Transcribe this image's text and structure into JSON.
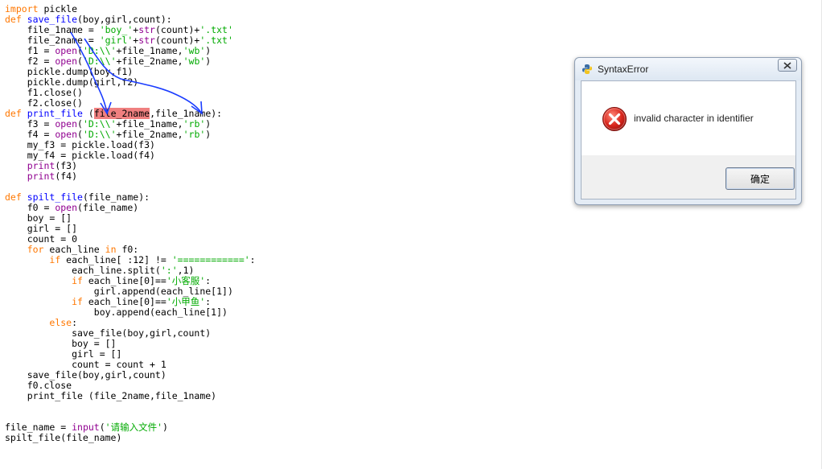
{
  "code_lines": [
    [
      {
        "t": "import",
        "c": "kw"
      },
      {
        "t": " pickle"
      }
    ],
    [
      {
        "t": "def",
        "c": "kw"
      },
      {
        "t": " "
      },
      {
        "t": "save_file",
        "c": "fn"
      },
      {
        "t": "(boy,girl,count):"
      }
    ],
    [
      {
        "t": "    file_1name = "
      },
      {
        "t": "'boy_'",
        "c": "str"
      },
      {
        "t": "+"
      },
      {
        "t": "str",
        "c": "bi"
      },
      {
        "t": "(count)+"
      },
      {
        "t": "'.txt'",
        "c": "str"
      }
    ],
    [
      {
        "t": "    file_2name = "
      },
      {
        "t": "'girl'",
        "c": "str"
      },
      {
        "t": "+"
      },
      {
        "t": "str",
        "c": "bi"
      },
      {
        "t": "(count)+"
      },
      {
        "t": "'.txt'",
        "c": "str"
      }
    ],
    [
      {
        "t": "    f1 = "
      },
      {
        "t": "open",
        "c": "bi"
      },
      {
        "t": "("
      },
      {
        "t": "'D:\\\\'",
        "c": "str"
      },
      {
        "t": "+file_1name,"
      },
      {
        "t": "'wb'",
        "c": "str"
      },
      {
        "t": ")"
      }
    ],
    [
      {
        "t": "    f2 = "
      },
      {
        "t": "open",
        "c": "bi"
      },
      {
        "t": "("
      },
      {
        "t": "'D:\\\\'",
        "c": "str"
      },
      {
        "t": "+file_2name,"
      },
      {
        "t": "'wb'",
        "c": "str"
      },
      {
        "t": ")"
      }
    ],
    [
      {
        "t": "    pickle.dump(boy,f1)"
      }
    ],
    [
      {
        "t": "    pickle.dump(girl,f2)"
      }
    ],
    [
      {
        "t": "    f1.close()"
      }
    ],
    [
      {
        "t": "    f2.close()"
      }
    ],
    [
      {
        "t": "def",
        "c": "kw"
      },
      {
        "t": " "
      },
      {
        "t": "print_file",
        "c": "fn"
      },
      {
        "t": " ("
      },
      {
        "t": "file_2name",
        "c": "err"
      },
      {
        "t": ",file_1name):"
      }
    ],
    [
      {
        "t": "    f3 = "
      },
      {
        "t": "open",
        "c": "bi"
      },
      {
        "t": "("
      },
      {
        "t": "'D:\\\\'",
        "c": "str"
      },
      {
        "t": "+file_1name,"
      },
      {
        "t": "'rb'",
        "c": "str"
      },
      {
        "t": ")"
      }
    ],
    [
      {
        "t": "    f4 = "
      },
      {
        "t": "open",
        "c": "bi"
      },
      {
        "t": "("
      },
      {
        "t": "'D:\\\\'",
        "c": "str"
      },
      {
        "t": "+file_2name,"
      },
      {
        "t": "'rb'",
        "c": "str"
      },
      {
        "t": ")"
      }
    ],
    [
      {
        "t": "    my_f3 = pickle.load(f3)"
      }
    ],
    [
      {
        "t": "    my_f4 = pickle.load(f4)"
      }
    ],
    [
      {
        "t": "    "
      },
      {
        "t": "print",
        "c": "bi"
      },
      {
        "t": "(f3)"
      }
    ],
    [
      {
        "t": "    "
      },
      {
        "t": "print",
        "c": "bi"
      },
      {
        "t": "(f4)"
      }
    ],
    [],
    [
      {
        "t": "def",
        "c": "kw"
      },
      {
        "t": " "
      },
      {
        "t": "spilt_file",
        "c": "fn"
      },
      {
        "t": "(file_name):"
      }
    ],
    [
      {
        "t": "    f0 = "
      },
      {
        "t": "open",
        "c": "bi"
      },
      {
        "t": "(file_name)"
      }
    ],
    [
      {
        "t": "    boy = []"
      }
    ],
    [
      {
        "t": "    girl = []"
      }
    ],
    [
      {
        "t": "    count = 0"
      }
    ],
    [
      {
        "t": "    "
      },
      {
        "t": "for",
        "c": "kw"
      },
      {
        "t": " each_line "
      },
      {
        "t": "in",
        "c": "kw"
      },
      {
        "t": " f0:"
      }
    ],
    [
      {
        "t": "        "
      },
      {
        "t": "if",
        "c": "kw"
      },
      {
        "t": " each_line[ :12] != "
      },
      {
        "t": "'============'",
        "c": "str"
      },
      {
        "t": ":"
      }
    ],
    [
      {
        "t": "            each_line.split("
      },
      {
        "t": "':'",
        "c": "str"
      },
      {
        "t": ",1)"
      }
    ],
    [
      {
        "t": "            "
      },
      {
        "t": "if",
        "c": "kw"
      },
      {
        "t": " each_line[0]=="
      },
      {
        "t": "'小客服'",
        "c": "str"
      },
      {
        "t": ":"
      }
    ],
    [
      {
        "t": "                girl.append(each_line[1])"
      }
    ],
    [
      {
        "t": "            "
      },
      {
        "t": "if",
        "c": "kw"
      },
      {
        "t": " each_line[0]=="
      },
      {
        "t": "'小甲鱼'",
        "c": "str"
      },
      {
        "t": ":"
      }
    ],
    [
      {
        "t": "                boy.append(each_line[1])"
      }
    ],
    [
      {
        "t": "        "
      },
      {
        "t": "else",
        "c": "kw"
      },
      {
        "t": ":"
      }
    ],
    [
      {
        "t": "            save_file(boy,girl,count)"
      }
    ],
    [
      {
        "t": "            boy = []"
      }
    ],
    [
      {
        "t": "            girl = []"
      }
    ],
    [
      {
        "t": "            count = count + 1"
      }
    ],
    [
      {
        "t": "    save_file(boy,girl,count)"
      }
    ],
    [
      {
        "t": "    f0.close"
      }
    ],
    [
      {
        "t": "    print_file (file_2name,file_1name)"
      }
    ],
    [],
    [],
    [
      {
        "t": "file_name = "
      },
      {
        "t": "input",
        "c": "bi"
      },
      {
        "t": "("
      },
      {
        "t": "'请输入文件'",
        "c": "str"
      },
      {
        "t": ")"
      }
    ],
    [
      {
        "t": "spilt_file(file_name)"
      }
    ]
  ],
  "dialog": {
    "title": "SyntaxError",
    "message": "invalid character in identifier",
    "ok_label": "确定",
    "icons": {
      "title": "python-icon",
      "message": "error-icon",
      "close": "close-icon"
    }
  },
  "colors": {
    "keyword": "#ff7700",
    "function_name": "#0000ff",
    "string": "#00aa00",
    "builtin": "#900090",
    "error_highlight": "#f08080",
    "annotation_pen": "#1a3cff"
  }
}
